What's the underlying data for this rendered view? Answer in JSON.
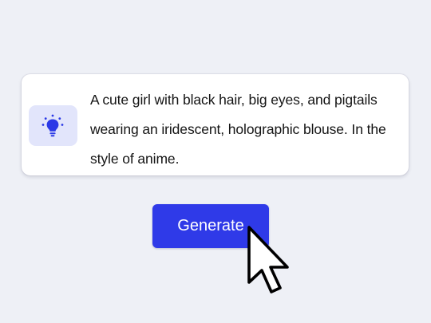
{
  "prompt": {
    "icon": "lightbulb-icon",
    "text": "A cute girl with black hair, big eyes, and pigtails wearing an iridescent, holographic blouse. In the style of anime."
  },
  "generate_button": {
    "label": "Generate"
  },
  "pointer": {
    "icon": "mouse-pointer-icon"
  },
  "colors": {
    "background": "#eef0f6",
    "accent": "#2f3ae8",
    "icon_tile": "#e2e5fb",
    "icon": "#2b39e6"
  }
}
